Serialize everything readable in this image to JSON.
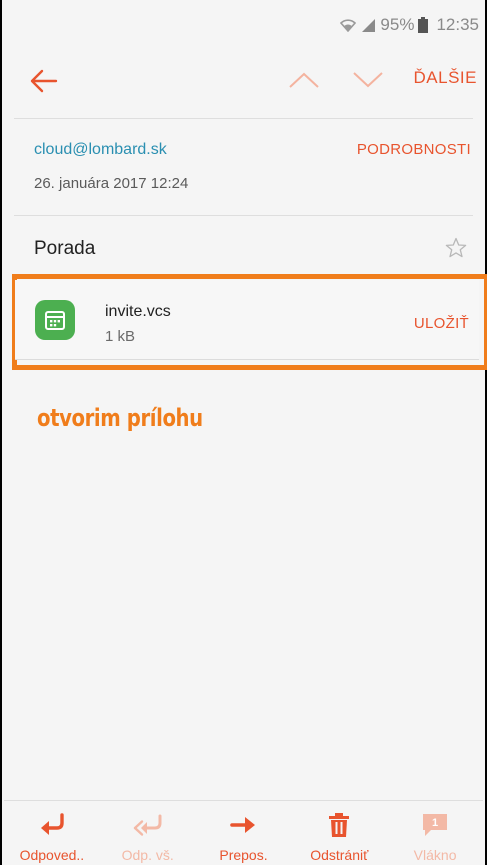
{
  "status_bar": {
    "battery_pct": "95%",
    "time": "12:35",
    "icons": [
      "wifi-icon",
      "signal-icon",
      "battery-icon"
    ]
  },
  "toolbar": {
    "next_label": "ĎALŠIE",
    "icons": [
      "back-arrow-icon",
      "chevron-up-icon",
      "chevron-down-icon"
    ]
  },
  "email": {
    "sender": "cloud@lombard.sk",
    "details_label": "PODROBNOSTI",
    "date": "26. januára 2017  12:24",
    "subject": "Porada"
  },
  "attachment": {
    "file_name": "invite.vcs",
    "file_size": "1 kB",
    "save_label": "ULOŽIŤ",
    "icon": "calendar-icon"
  },
  "annotation": {
    "text": "otvorim prílohu",
    "color": "#f07d1b"
  },
  "bottom_bar": {
    "reply": "Odpoved..",
    "reply_all": "Odp. vš.",
    "forward": "Prepos.",
    "delete": "Odstrániť",
    "thread": "Vlákno",
    "thread_count": "1"
  },
  "colors": {
    "accent": "#e8542e",
    "link": "#2a8fb1",
    "highlight": "#f07d1b",
    "calendar": "#4caf50"
  }
}
